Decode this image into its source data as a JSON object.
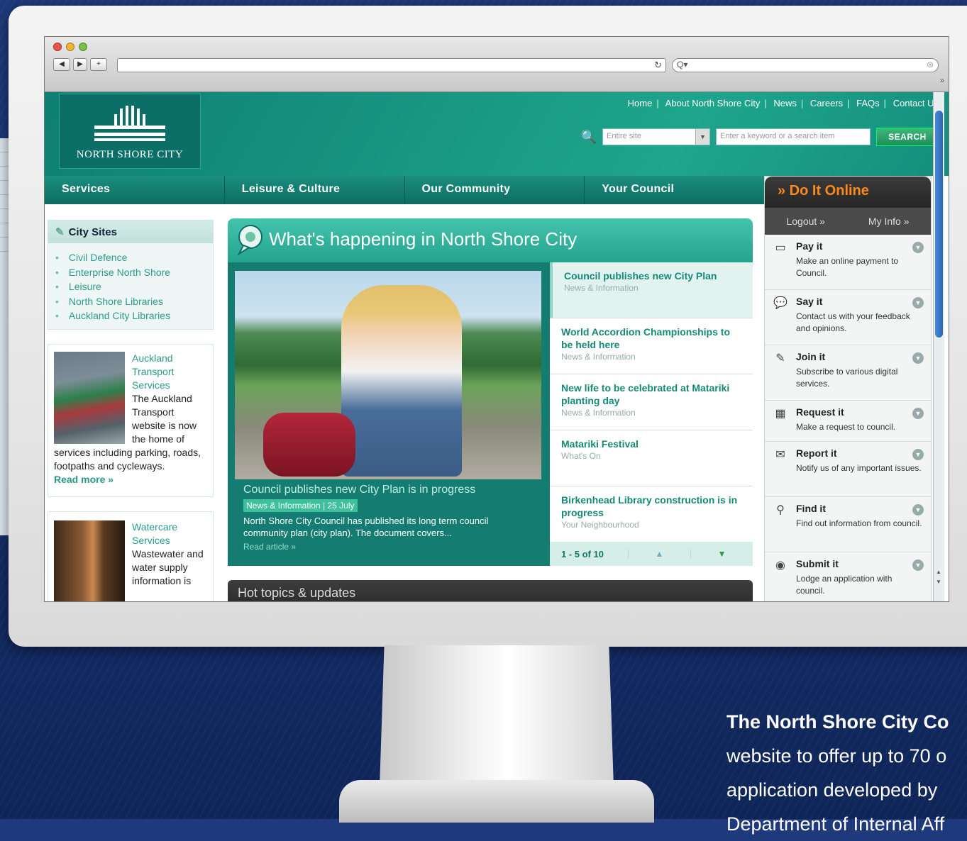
{
  "browser": {
    "search_placeholder": "Q▾"
  },
  "site": {
    "logo_text": "NORTH SHORE CITY",
    "top_links": [
      "Home",
      "About North Shore City",
      "News",
      "Careers",
      "FAQs",
      "Contact Us"
    ],
    "search": {
      "scope_value": "Entire site",
      "keyword_placeholder": "Enter a keyword or a search item",
      "button_label": "SEARCH"
    },
    "main_nav": [
      "Services",
      "Leisure & Culture",
      "Our Community",
      "Your Council"
    ],
    "city_sites": {
      "title": "City Sites",
      "items": [
        "Civil Defence",
        "Enterprise North Shore",
        "Leisure",
        "North Shore Libraries",
        "Auckland City Libraries"
      ]
    },
    "promo1": {
      "title": "Auckland Transport Services",
      "body": "The Auckland Transport website is now the home of services including parking, roads, footpaths and cycleways.",
      "link": "Read more »"
    },
    "promo2": {
      "title": "Watercare Services",
      "body": "Wastewater and water supply information is"
    },
    "whats_happening": {
      "title": "What's happening in North Shore City",
      "feature": {
        "title": "Council publishes new City Plan is in progress",
        "tag": "News & Information  |  25 July",
        "text": "North Shore City Council has published its long term council community plan (city plan). The document covers...",
        "link": "Read article »"
      },
      "news": [
        {
          "title": "Council publishes new City Plan",
          "sub": "News & Information"
        },
        {
          "title": "World Accordion Championships to be held here",
          "sub": "News & Information"
        },
        {
          "title": "New life to be celebrated at Matariki planting day",
          "sub": "News & Information"
        },
        {
          "title": "Matariki Festival",
          "sub": "What's On"
        },
        {
          "title": "Birkenhead Library construction is in progress",
          "sub": "Your Neighbourhood"
        }
      ],
      "pager": "1 - 5 of 10"
    },
    "hot_topics": "Hot topics & updates",
    "do_it_online": {
      "title": "» Do It Online",
      "logout": "Logout »",
      "my_info": "My Info »",
      "items": [
        {
          "title": "Pay it",
          "desc": "Make an online payment to Council.",
          "icon": "pay-icon"
        },
        {
          "title": "Say it",
          "desc": "Contact us with your feedback and opinions.",
          "icon": "speech-icon"
        },
        {
          "title": "Join it",
          "desc": "Subscribe to various digital services.",
          "icon": "pen-icon"
        },
        {
          "title": "Request it",
          "desc": "Make a request to council.",
          "icon": "calendar-icon"
        },
        {
          "title": "Report it",
          "desc": "Notify us of any important issues.",
          "icon": "mail-icon"
        },
        {
          "title": "Find it",
          "desc": "Find out information from council.",
          "icon": "magnifier-icon"
        },
        {
          "title": "Submit it",
          "desc": "Lodge an application with council.",
          "icon": "submit-icon"
        }
      ]
    }
  },
  "tagline": {
    "heading": "The North Shore City Co",
    "lines": [
      "website to offer up to 70 o",
      "application developed by",
      "Department of Internal Aff"
    ]
  },
  "colors": {
    "brand_teal": "#1b9a86",
    "accent_orange": "#ff8a1c"
  }
}
